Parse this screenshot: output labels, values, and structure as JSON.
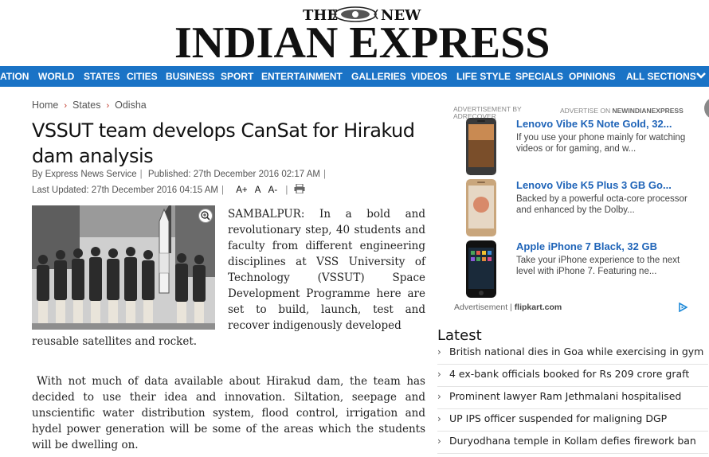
{
  "masthead": {
    "the": "THE",
    "new": "NEW",
    "name": "INDIAN EXPRESS"
  },
  "nav": {
    "items": [
      "ATION",
      "WORLD",
      "STATES",
      "CITIES",
      "BUSINESS",
      "SPORT",
      "ENTERTAINMENT",
      "GALLERIES",
      "VIDEOS",
      "LIFE STYLE",
      "SPECIALS",
      "OPINIONS",
      "ALL SECTIONS"
    ],
    "color": "#1a73c6"
  },
  "breadcrumb": {
    "home": "Home",
    "states": "States",
    "odisha": "Odisha",
    "separator": "›"
  },
  "article": {
    "headline": "VSSUT team develops CanSat for Hirakud dam analysis",
    "author": "By Express News Service",
    "published": "Published: 27th December 2016 02:17 AM",
    "updated": "Last Updated: 27th December 2016 04:15 AM",
    "font_size": {
      "inc": "A+",
      "normal": "A",
      "dec": "A-"
    },
    "para1_top": "SAMBALPUR: In a bold and revolutionary step, 40 students and faculty from different engineering disciplines at VSS University of Technology (VSSUT) Space Development Programme here are set to build, launch, test and recover indigenously developed",
    "para1_bottom": "reusable satellites and rocket.",
    "para2": "With not much of data available about Hirakud dam, the team has decided to use their idea and innovation. Siltation, seepage and unscientific water distribution system, flood control, irrigation and hydel power generation will be some of the areas which the students will be dwelling on."
  },
  "ads": {
    "label_left": "ADVERTISEMENT BY ADRECOVER",
    "label_right_prefix": "ADVERTISE ON ",
    "label_right_site": "NEWINDIANEXPRESS",
    "items": [
      {
        "title": "Lenovo Vibe K5 Note Gold, 32...",
        "desc": "If you use your phone mainly for watching videos or for gaming, and w..."
      },
      {
        "title": "Lenovo Vibe K5 Plus 3 GB Go...",
        "desc": "Backed by a powerful octa-core processor and enhanced by the Dolby..."
      },
      {
        "title": "Apple iPhone 7 Black, 32 GB",
        "desc": "Take your iPhone experience to the next level with iPhone 7. Featuring ne..."
      }
    ],
    "footer_prefix": "Advertisement | ",
    "footer_brand": "flipkart.com",
    "accent": "#1f64b8"
  },
  "latest": {
    "title": "Latest",
    "items": [
      "British national dies in Goa while exercising in gym",
      "4 ex-bank officials booked for Rs 209 crore graft",
      "Prominent lawyer Ram Jethmalani hospitalised",
      "UP IPS officer suspended for maligning DGP",
      "Duryodhana temple in Kollam defies firework ban"
    ]
  }
}
